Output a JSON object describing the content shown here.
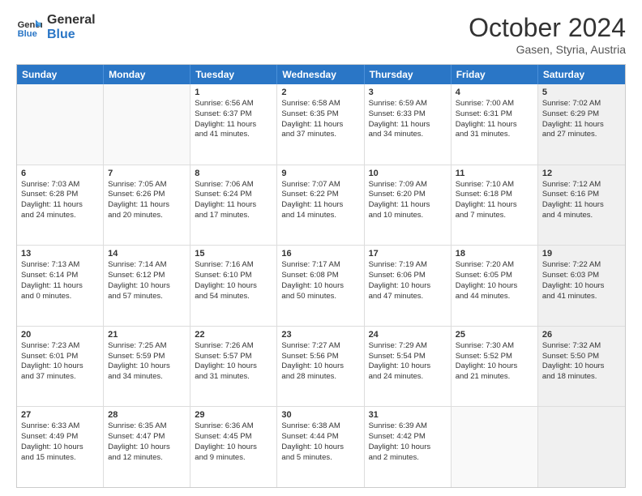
{
  "header": {
    "logo_line1": "General",
    "logo_line2": "Blue",
    "month": "October 2024",
    "location": "Gasen, Styria, Austria"
  },
  "weekdays": [
    "Sunday",
    "Monday",
    "Tuesday",
    "Wednesday",
    "Thursday",
    "Friday",
    "Saturday"
  ],
  "rows": [
    [
      {
        "day": "",
        "lines": [],
        "shaded": false,
        "empty": true
      },
      {
        "day": "",
        "lines": [],
        "shaded": false,
        "empty": true
      },
      {
        "day": "1",
        "lines": [
          "Sunrise: 6:56 AM",
          "Sunset: 6:37 PM",
          "Daylight: 11 hours",
          "and 41 minutes."
        ],
        "shaded": false,
        "empty": false
      },
      {
        "day": "2",
        "lines": [
          "Sunrise: 6:58 AM",
          "Sunset: 6:35 PM",
          "Daylight: 11 hours",
          "and 37 minutes."
        ],
        "shaded": false,
        "empty": false
      },
      {
        "day": "3",
        "lines": [
          "Sunrise: 6:59 AM",
          "Sunset: 6:33 PM",
          "Daylight: 11 hours",
          "and 34 minutes."
        ],
        "shaded": false,
        "empty": false
      },
      {
        "day": "4",
        "lines": [
          "Sunrise: 7:00 AM",
          "Sunset: 6:31 PM",
          "Daylight: 11 hours",
          "and 31 minutes."
        ],
        "shaded": false,
        "empty": false
      },
      {
        "day": "5",
        "lines": [
          "Sunrise: 7:02 AM",
          "Sunset: 6:29 PM",
          "Daylight: 11 hours",
          "and 27 minutes."
        ],
        "shaded": true,
        "empty": false
      }
    ],
    [
      {
        "day": "6",
        "lines": [
          "Sunrise: 7:03 AM",
          "Sunset: 6:28 PM",
          "Daylight: 11 hours",
          "and 24 minutes."
        ],
        "shaded": false,
        "empty": false
      },
      {
        "day": "7",
        "lines": [
          "Sunrise: 7:05 AM",
          "Sunset: 6:26 PM",
          "Daylight: 11 hours",
          "and 20 minutes."
        ],
        "shaded": false,
        "empty": false
      },
      {
        "day": "8",
        "lines": [
          "Sunrise: 7:06 AM",
          "Sunset: 6:24 PM",
          "Daylight: 11 hours",
          "and 17 minutes."
        ],
        "shaded": false,
        "empty": false
      },
      {
        "day": "9",
        "lines": [
          "Sunrise: 7:07 AM",
          "Sunset: 6:22 PM",
          "Daylight: 11 hours",
          "and 14 minutes."
        ],
        "shaded": false,
        "empty": false
      },
      {
        "day": "10",
        "lines": [
          "Sunrise: 7:09 AM",
          "Sunset: 6:20 PM",
          "Daylight: 11 hours",
          "and 10 minutes."
        ],
        "shaded": false,
        "empty": false
      },
      {
        "day": "11",
        "lines": [
          "Sunrise: 7:10 AM",
          "Sunset: 6:18 PM",
          "Daylight: 11 hours",
          "and 7 minutes."
        ],
        "shaded": false,
        "empty": false
      },
      {
        "day": "12",
        "lines": [
          "Sunrise: 7:12 AM",
          "Sunset: 6:16 PM",
          "Daylight: 11 hours",
          "and 4 minutes."
        ],
        "shaded": true,
        "empty": false
      }
    ],
    [
      {
        "day": "13",
        "lines": [
          "Sunrise: 7:13 AM",
          "Sunset: 6:14 PM",
          "Daylight: 11 hours",
          "and 0 minutes."
        ],
        "shaded": false,
        "empty": false
      },
      {
        "day": "14",
        "lines": [
          "Sunrise: 7:14 AM",
          "Sunset: 6:12 PM",
          "Daylight: 10 hours",
          "and 57 minutes."
        ],
        "shaded": false,
        "empty": false
      },
      {
        "day": "15",
        "lines": [
          "Sunrise: 7:16 AM",
          "Sunset: 6:10 PM",
          "Daylight: 10 hours",
          "and 54 minutes."
        ],
        "shaded": false,
        "empty": false
      },
      {
        "day": "16",
        "lines": [
          "Sunrise: 7:17 AM",
          "Sunset: 6:08 PM",
          "Daylight: 10 hours",
          "and 50 minutes."
        ],
        "shaded": false,
        "empty": false
      },
      {
        "day": "17",
        "lines": [
          "Sunrise: 7:19 AM",
          "Sunset: 6:06 PM",
          "Daylight: 10 hours",
          "and 47 minutes."
        ],
        "shaded": false,
        "empty": false
      },
      {
        "day": "18",
        "lines": [
          "Sunrise: 7:20 AM",
          "Sunset: 6:05 PM",
          "Daylight: 10 hours",
          "and 44 minutes."
        ],
        "shaded": false,
        "empty": false
      },
      {
        "day": "19",
        "lines": [
          "Sunrise: 7:22 AM",
          "Sunset: 6:03 PM",
          "Daylight: 10 hours",
          "and 41 minutes."
        ],
        "shaded": true,
        "empty": false
      }
    ],
    [
      {
        "day": "20",
        "lines": [
          "Sunrise: 7:23 AM",
          "Sunset: 6:01 PM",
          "Daylight: 10 hours",
          "and 37 minutes."
        ],
        "shaded": false,
        "empty": false
      },
      {
        "day": "21",
        "lines": [
          "Sunrise: 7:25 AM",
          "Sunset: 5:59 PM",
          "Daylight: 10 hours",
          "and 34 minutes."
        ],
        "shaded": false,
        "empty": false
      },
      {
        "day": "22",
        "lines": [
          "Sunrise: 7:26 AM",
          "Sunset: 5:57 PM",
          "Daylight: 10 hours",
          "and 31 minutes."
        ],
        "shaded": false,
        "empty": false
      },
      {
        "day": "23",
        "lines": [
          "Sunrise: 7:27 AM",
          "Sunset: 5:56 PM",
          "Daylight: 10 hours",
          "and 28 minutes."
        ],
        "shaded": false,
        "empty": false
      },
      {
        "day": "24",
        "lines": [
          "Sunrise: 7:29 AM",
          "Sunset: 5:54 PM",
          "Daylight: 10 hours",
          "and 24 minutes."
        ],
        "shaded": false,
        "empty": false
      },
      {
        "day": "25",
        "lines": [
          "Sunrise: 7:30 AM",
          "Sunset: 5:52 PM",
          "Daylight: 10 hours",
          "and 21 minutes."
        ],
        "shaded": false,
        "empty": false
      },
      {
        "day": "26",
        "lines": [
          "Sunrise: 7:32 AM",
          "Sunset: 5:50 PM",
          "Daylight: 10 hours",
          "and 18 minutes."
        ],
        "shaded": true,
        "empty": false
      }
    ],
    [
      {
        "day": "27",
        "lines": [
          "Sunrise: 6:33 AM",
          "Sunset: 4:49 PM",
          "Daylight: 10 hours",
          "and 15 minutes."
        ],
        "shaded": false,
        "empty": false
      },
      {
        "day": "28",
        "lines": [
          "Sunrise: 6:35 AM",
          "Sunset: 4:47 PM",
          "Daylight: 10 hours",
          "and 12 minutes."
        ],
        "shaded": false,
        "empty": false
      },
      {
        "day": "29",
        "lines": [
          "Sunrise: 6:36 AM",
          "Sunset: 4:45 PM",
          "Daylight: 10 hours",
          "and 9 minutes."
        ],
        "shaded": false,
        "empty": false
      },
      {
        "day": "30",
        "lines": [
          "Sunrise: 6:38 AM",
          "Sunset: 4:44 PM",
          "Daylight: 10 hours",
          "and 5 minutes."
        ],
        "shaded": false,
        "empty": false
      },
      {
        "day": "31",
        "lines": [
          "Sunrise: 6:39 AM",
          "Sunset: 4:42 PM",
          "Daylight: 10 hours",
          "and 2 minutes."
        ],
        "shaded": false,
        "empty": false
      },
      {
        "day": "",
        "lines": [],
        "shaded": false,
        "empty": true
      },
      {
        "day": "",
        "lines": [],
        "shaded": true,
        "empty": true
      }
    ]
  ]
}
